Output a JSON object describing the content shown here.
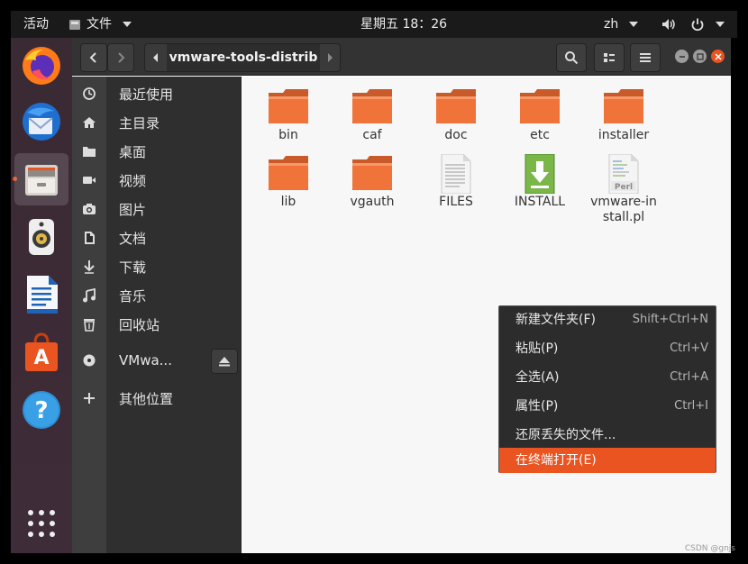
{
  "topbar": {
    "activities": "活动",
    "app_menu": "文件",
    "clock": "星期五 18：26",
    "input_method": "zh"
  },
  "dock": {
    "apps": [
      "firefox-icon",
      "thunderbird-icon",
      "files-icon",
      "rhythmbox-icon",
      "libreoffice-writer-icon",
      "software-center-icon",
      "help-icon",
      "show-apps-icon"
    ]
  },
  "header": {
    "path": "vmware-tools-distrib"
  },
  "sidebar": {
    "items": [
      {
        "label": "最近使用",
        "icon": "clock-icon"
      },
      {
        "label": "主目录",
        "icon": "home-icon"
      },
      {
        "label": "桌面",
        "icon": "folder-icon"
      },
      {
        "label": "视频",
        "icon": "video-icon"
      },
      {
        "label": "图片",
        "icon": "camera-icon"
      },
      {
        "label": "文档",
        "icon": "document-icon"
      },
      {
        "label": "下载",
        "icon": "download-icon"
      },
      {
        "label": "音乐",
        "icon": "music-icon"
      },
      {
        "label": "回收站",
        "icon": "trash-icon"
      }
    ],
    "device": {
      "label": "VMwa...",
      "icon": "disc-icon"
    },
    "other": {
      "label": "其他位置",
      "icon": "plus-icon"
    }
  },
  "files": [
    {
      "name": "bin",
      "type": "folder"
    },
    {
      "name": "caf",
      "type": "folder"
    },
    {
      "name": "doc",
      "type": "folder"
    },
    {
      "name": "etc",
      "type": "folder"
    },
    {
      "name": "installer",
      "type": "folder"
    },
    {
      "name": "lib",
      "type": "folder"
    },
    {
      "name": "vgauth",
      "type": "folder"
    },
    {
      "name": "FILES",
      "type": "text"
    },
    {
      "name": "INSTALL",
      "type": "install"
    },
    {
      "name": "vmware-install.pl",
      "type": "perl"
    }
  ],
  "perl_badge": "Perl",
  "context_menu": [
    {
      "label": "新建文件夹(F)",
      "shortcut": "Shift+Ctrl+N"
    },
    {
      "label": "粘贴(P)",
      "shortcut": "Ctrl+V"
    },
    {
      "label": "全选(A)",
      "shortcut": "Ctrl+A"
    },
    {
      "label": "属性(P)",
      "shortcut": "Ctrl+I"
    },
    {
      "label": "还原丢失的文件...",
      "shortcut": ""
    },
    {
      "label": "在终端打开(E)",
      "shortcut": ""
    }
  ],
  "colors": {
    "accent": "#e95420",
    "folder": "#f0733a"
  },
  "watermark": "CSDN @gnjs"
}
